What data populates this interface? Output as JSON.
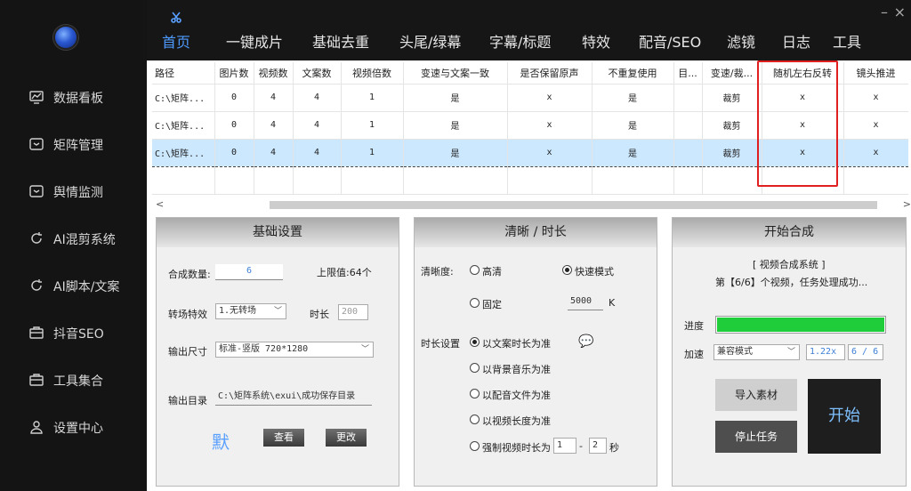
{
  "sidebar": {
    "items": [
      {
        "label": "数据看板",
        "icon": "chart-monitor-icon"
      },
      {
        "label": "矩阵管理",
        "icon": "folder-icon"
      },
      {
        "label": "舆情监测",
        "icon": "folder-icon"
      },
      {
        "label": "AI混剪系统",
        "icon": "refresh-icon"
      },
      {
        "label": "AI脚本/文案",
        "icon": "refresh-icon"
      },
      {
        "label": "抖音SEO",
        "icon": "briefcase-icon"
      },
      {
        "label": "工具集合",
        "icon": "briefcase-icon"
      },
      {
        "label": "设置中心",
        "icon": "user-icon"
      }
    ]
  },
  "topbar": {
    "tabs": [
      "首页",
      "一键成片",
      "基础去重",
      "头尾/绿幕",
      "字幕/标题",
      "特效",
      "配音/SEO",
      "滤镜",
      "日志",
      "工具"
    ],
    "active_tab": 0,
    "minimize": "–",
    "close": "×"
  },
  "table": {
    "headers": [
      "路径",
      "图片数",
      "视频数",
      "文案数",
      "视频倍数",
      "变速与文案一致",
      "是否保留原声",
      "不重复使用",
      "目...",
      "变速/裁...",
      "随机左右反转",
      "镜头推进"
    ],
    "rows": [
      [
        "C:\\矩阵...",
        "0",
        "4",
        "4",
        "1",
        "是",
        "x",
        "是",
        "",
        "裁剪",
        "x",
        "x"
      ],
      [
        "C:\\矩阵...",
        "0",
        "4",
        "4",
        "1",
        "是",
        "x",
        "是",
        "",
        "裁剪",
        "x",
        "x"
      ],
      [
        "C:\\矩阵...",
        "0",
        "4",
        "4",
        "1",
        "是",
        "x",
        "是",
        "",
        "裁剪",
        "x",
        "x"
      ]
    ],
    "selected_row": 2
  },
  "scrollbar": {
    "left_arrow": "<",
    "right_arrow": ">"
  },
  "basic": {
    "title": "基础设置",
    "count_label": "合成数量:",
    "count_value": "6",
    "limit_label": "上限值:64个",
    "transition_label": "转场特效",
    "transition_value": "1.无转场",
    "duration_label": "时长",
    "duration_placeholder": "200",
    "size_label": "输出尺寸",
    "size_value": "标准-竖版 720*1280",
    "dir_label": "输出目录",
    "dir_value": "C:\\矩阵系统\\exui\\成功保存目录",
    "default_label": "默",
    "view_btn": "查看",
    "change_btn": "更改"
  },
  "clarity": {
    "title": "清晰 / 时长",
    "clarity_label": "清晰度:",
    "opt_hd": "高清",
    "opt_fast": "快速模式",
    "opt_fixed": "固定",
    "bitrate_value": "5000",
    "bitrate_unit": "K",
    "duration_label": "时长设置",
    "d_opt1": "以文案时长为准",
    "d_opt2": "以背景音乐为准",
    "d_opt3": "以配音文件为准",
    "d_opt4": "以视频长度为准",
    "d_opt5": "强制视频时长为",
    "force_min": "1",
    "force_dash": "-",
    "force_max": "2",
    "force_unit": "秒"
  },
  "compose": {
    "title": "开始合成",
    "sys_name": "[ 视频合成系统 ]",
    "status": "第【6/6】个视频，任务处理成功...",
    "progress_label": "进度",
    "progress": 1.0,
    "speed_label": "加速",
    "speed_mode": "兼容模式",
    "speed_rate": "1.22x",
    "speed_count": "6 / 6",
    "import_btn": "导入素材",
    "stop_btn": "停止任务",
    "start_btn": "开始"
  },
  "colors": {
    "accent": "#4d9bff",
    "progress": "#1fcc3a",
    "highlight_box": "#e02020",
    "selected_row": "#cce8ff"
  }
}
